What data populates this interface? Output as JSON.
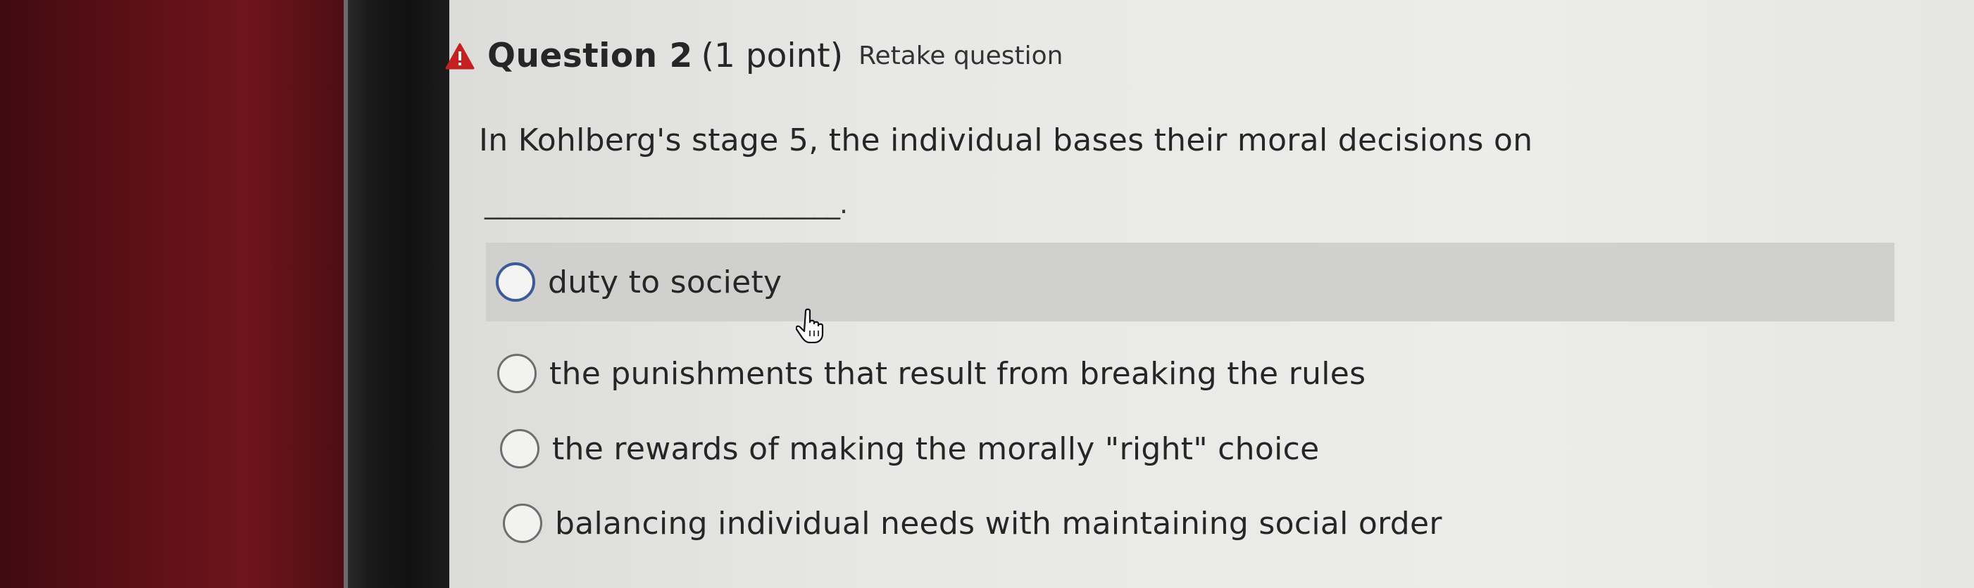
{
  "question": {
    "title": "Question 2",
    "points": "(1 point)",
    "retake": "Retake question",
    "warning_icon": "warning-triangle-icon",
    "text": "In Kohlberg's stage 5, the individual bases their moral decisions on",
    "blank": "____________________________."
  },
  "options": [
    {
      "label": "duty to society",
      "selected": false,
      "hovered": true
    },
    {
      "label": "the punishments that result from breaking the rules",
      "selected": false
    },
    {
      "label": "the rewards of making the morally \"right\" choice",
      "selected": false
    },
    {
      "label": "balancing individual needs with maintaining social order",
      "selected": false
    }
  ],
  "colors": {
    "warning": "#c42020",
    "hover_ring": "#3a5a9a",
    "highlight": "#d0d0ce"
  }
}
